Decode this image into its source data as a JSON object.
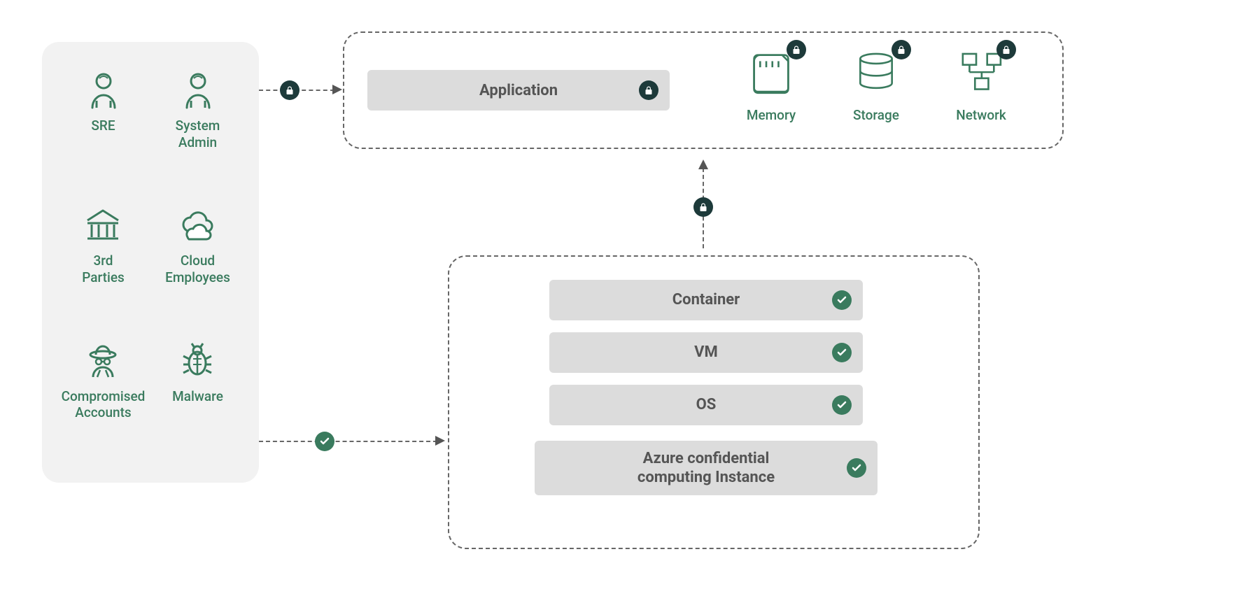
{
  "actors": {
    "sre": "SRE",
    "sysadmin": "System\nAdmin",
    "thirdparties": "3rd\nParties",
    "cloudemp": "Cloud\nEmployees",
    "compromised": "Compromised\nAccounts",
    "malware": "Malware"
  },
  "app_bar": "Application",
  "resources": {
    "memory": "Memory",
    "storage": "Storage",
    "network": "Network"
  },
  "stack": {
    "container": "Container",
    "vm": "VM",
    "os": "OS",
    "azure": "Azure confidential\ncomputing Instance"
  }
}
